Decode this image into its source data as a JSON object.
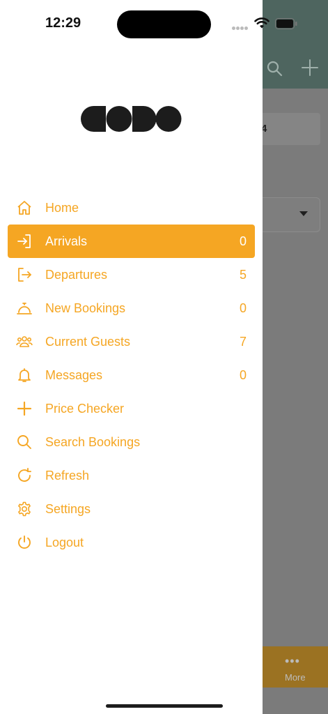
{
  "status_bar": {
    "time": "12:29"
  },
  "background": {
    "card_text": "4",
    "tab_more_label": "More",
    "tab_more_dots": "•••"
  },
  "brand": {
    "logo_name": "codo-logo"
  },
  "colors": {
    "accent": "#f5a623",
    "active_text": "#ffffff",
    "header_bg": "#4e655f"
  },
  "menu": {
    "items": [
      {
        "label": "Home",
        "count": "",
        "icon": "home-icon"
      },
      {
        "label": "Arrivals",
        "count": "0",
        "icon": "sign-in-icon",
        "active": true
      },
      {
        "label": "Departures",
        "count": "5",
        "icon": "sign-out-icon"
      },
      {
        "label": "New Bookings",
        "count": "0",
        "icon": "bell-concierge-icon"
      },
      {
        "label": "Current Guests",
        "count": "7",
        "icon": "users-icon"
      },
      {
        "label": "Messages",
        "count": "0",
        "icon": "bell-icon"
      },
      {
        "label": "Price Checker",
        "count": "",
        "icon": "plus-icon"
      },
      {
        "label": "Search Bookings",
        "count": "",
        "icon": "search-icon"
      },
      {
        "label": "Refresh",
        "count": "",
        "icon": "refresh-icon"
      },
      {
        "label": "Settings",
        "count": "",
        "icon": "gear-icon"
      },
      {
        "label": "Logout",
        "count": "",
        "icon": "power-icon"
      }
    ]
  }
}
